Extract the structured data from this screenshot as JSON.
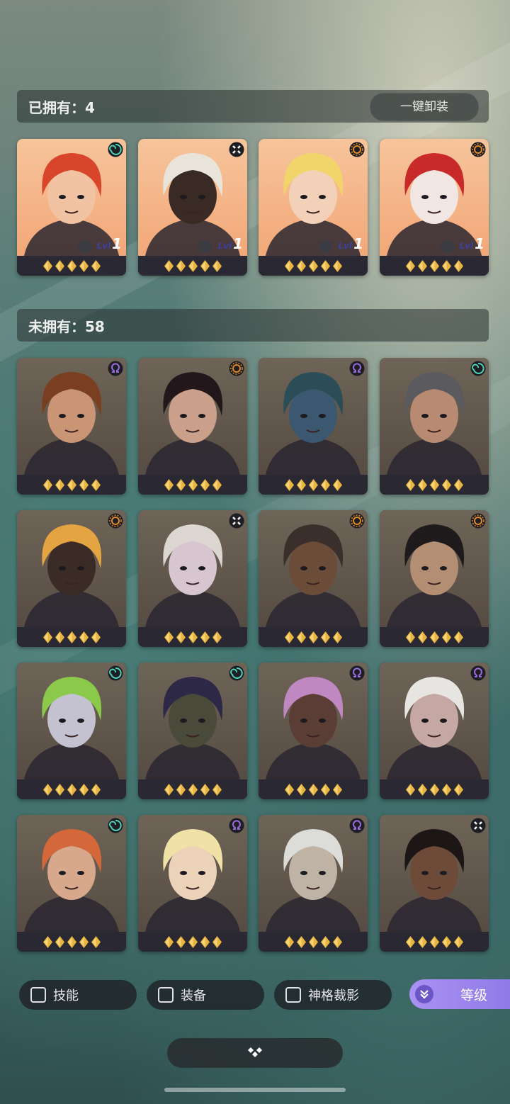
{
  "owned_section": {
    "title": "已拥有：4",
    "unequip_label": "一键卸装"
  },
  "unowned_section": {
    "title": "未拥有：58"
  },
  "owned_heroes": [
    {
      "faction": "swirl-icon",
      "level_prefix": "Lvl",
      "level": "1",
      "stars": 5,
      "hair": "#d8452a",
      "skin": "#f1c3a3"
    },
    {
      "faction": "cross-icon",
      "level_prefix": "Lvl",
      "level": "1",
      "stars": 5,
      "hair": "#e8e4da",
      "skin": "#3a2a26"
    },
    {
      "faction": "sun-icon",
      "level_prefix": "Lvl",
      "level": "1",
      "stars": 5,
      "hair": "#f1d56b",
      "skin": "#f3d1b8"
    },
    {
      "faction": "sun-icon",
      "level_prefix": "Lvl",
      "level": "1",
      "stars": 5,
      "hair": "#c82a2a",
      "skin": "#f1e6e2"
    }
  ],
  "unowned_heroes": [
    {
      "faction": "omega-icon",
      "stars": 5,
      "hair": "#7a3e20",
      "skin": "#c99574"
    },
    {
      "faction": "sun-icon",
      "stars": 5,
      "hair": "#22181b",
      "skin": "#caa08b"
    },
    {
      "faction": "omega-icon",
      "stars": 5,
      "hair": "#2b4d57",
      "skin": "#3b5870"
    },
    {
      "faction": "swirl-icon",
      "stars": 5,
      "hair": "#5b5b5f",
      "skin": "#b98a72"
    },
    {
      "faction": "sun-icon",
      "stars": 5,
      "hair": "#e5a442",
      "skin": "#3a2b26"
    },
    {
      "faction": "cross-icon",
      "stars": 5,
      "hair": "#dcd6d0",
      "skin": "#d7c6cf"
    },
    {
      "faction": "sun-icon",
      "stars": 5,
      "hair": "#3b2f2c",
      "skin": "#6b4c39"
    },
    {
      "faction": "sun-icon",
      "stars": 5,
      "hair": "#1f1a1b",
      "skin": "#b48e73"
    },
    {
      "faction": "swirl-icon",
      "stars": 5,
      "hair": "#8bc94a",
      "skin": "#c4c2d0"
    },
    {
      "faction": "swirl-icon",
      "stars": 5,
      "hair": "#2d2846",
      "skin": "#4a4a3a"
    },
    {
      "faction": "omega-icon",
      "stars": 5,
      "hair": "#c088c0",
      "skin": "#5a3e35"
    },
    {
      "faction": "omega-icon",
      "stars": 5,
      "hair": "#e7e5e2",
      "skin": "#c5a8a3"
    },
    {
      "faction": "swirl-icon",
      "stars": 5,
      "hair": "#d4683a",
      "skin": "#d8a88c"
    },
    {
      "faction": "omega-icon",
      "stars": 5,
      "hair": "#f0e2a6",
      "skin": "#ecd2b8"
    },
    {
      "faction": "omega-icon",
      "stars": 5,
      "hair": "#dcdcd8",
      "skin": "#bfb3a6"
    },
    {
      "faction": "cross-icon",
      "stars": 5,
      "hair": "#1c1716",
      "skin": "#6e4b39"
    }
  ],
  "filters": [
    {
      "label": "技能"
    },
    {
      "label": "装备"
    },
    {
      "label": "神格裁影"
    }
  ],
  "sort_button": {
    "label": "等级"
  },
  "colors": {
    "accent": "#9a84ee",
    "star_gold": "#e9b540",
    "faction_swirl": "#4dd3b8",
    "faction_sun": "#e28a2a",
    "faction_omega": "#9c6adf",
    "faction_cross": "#ffffff"
  }
}
